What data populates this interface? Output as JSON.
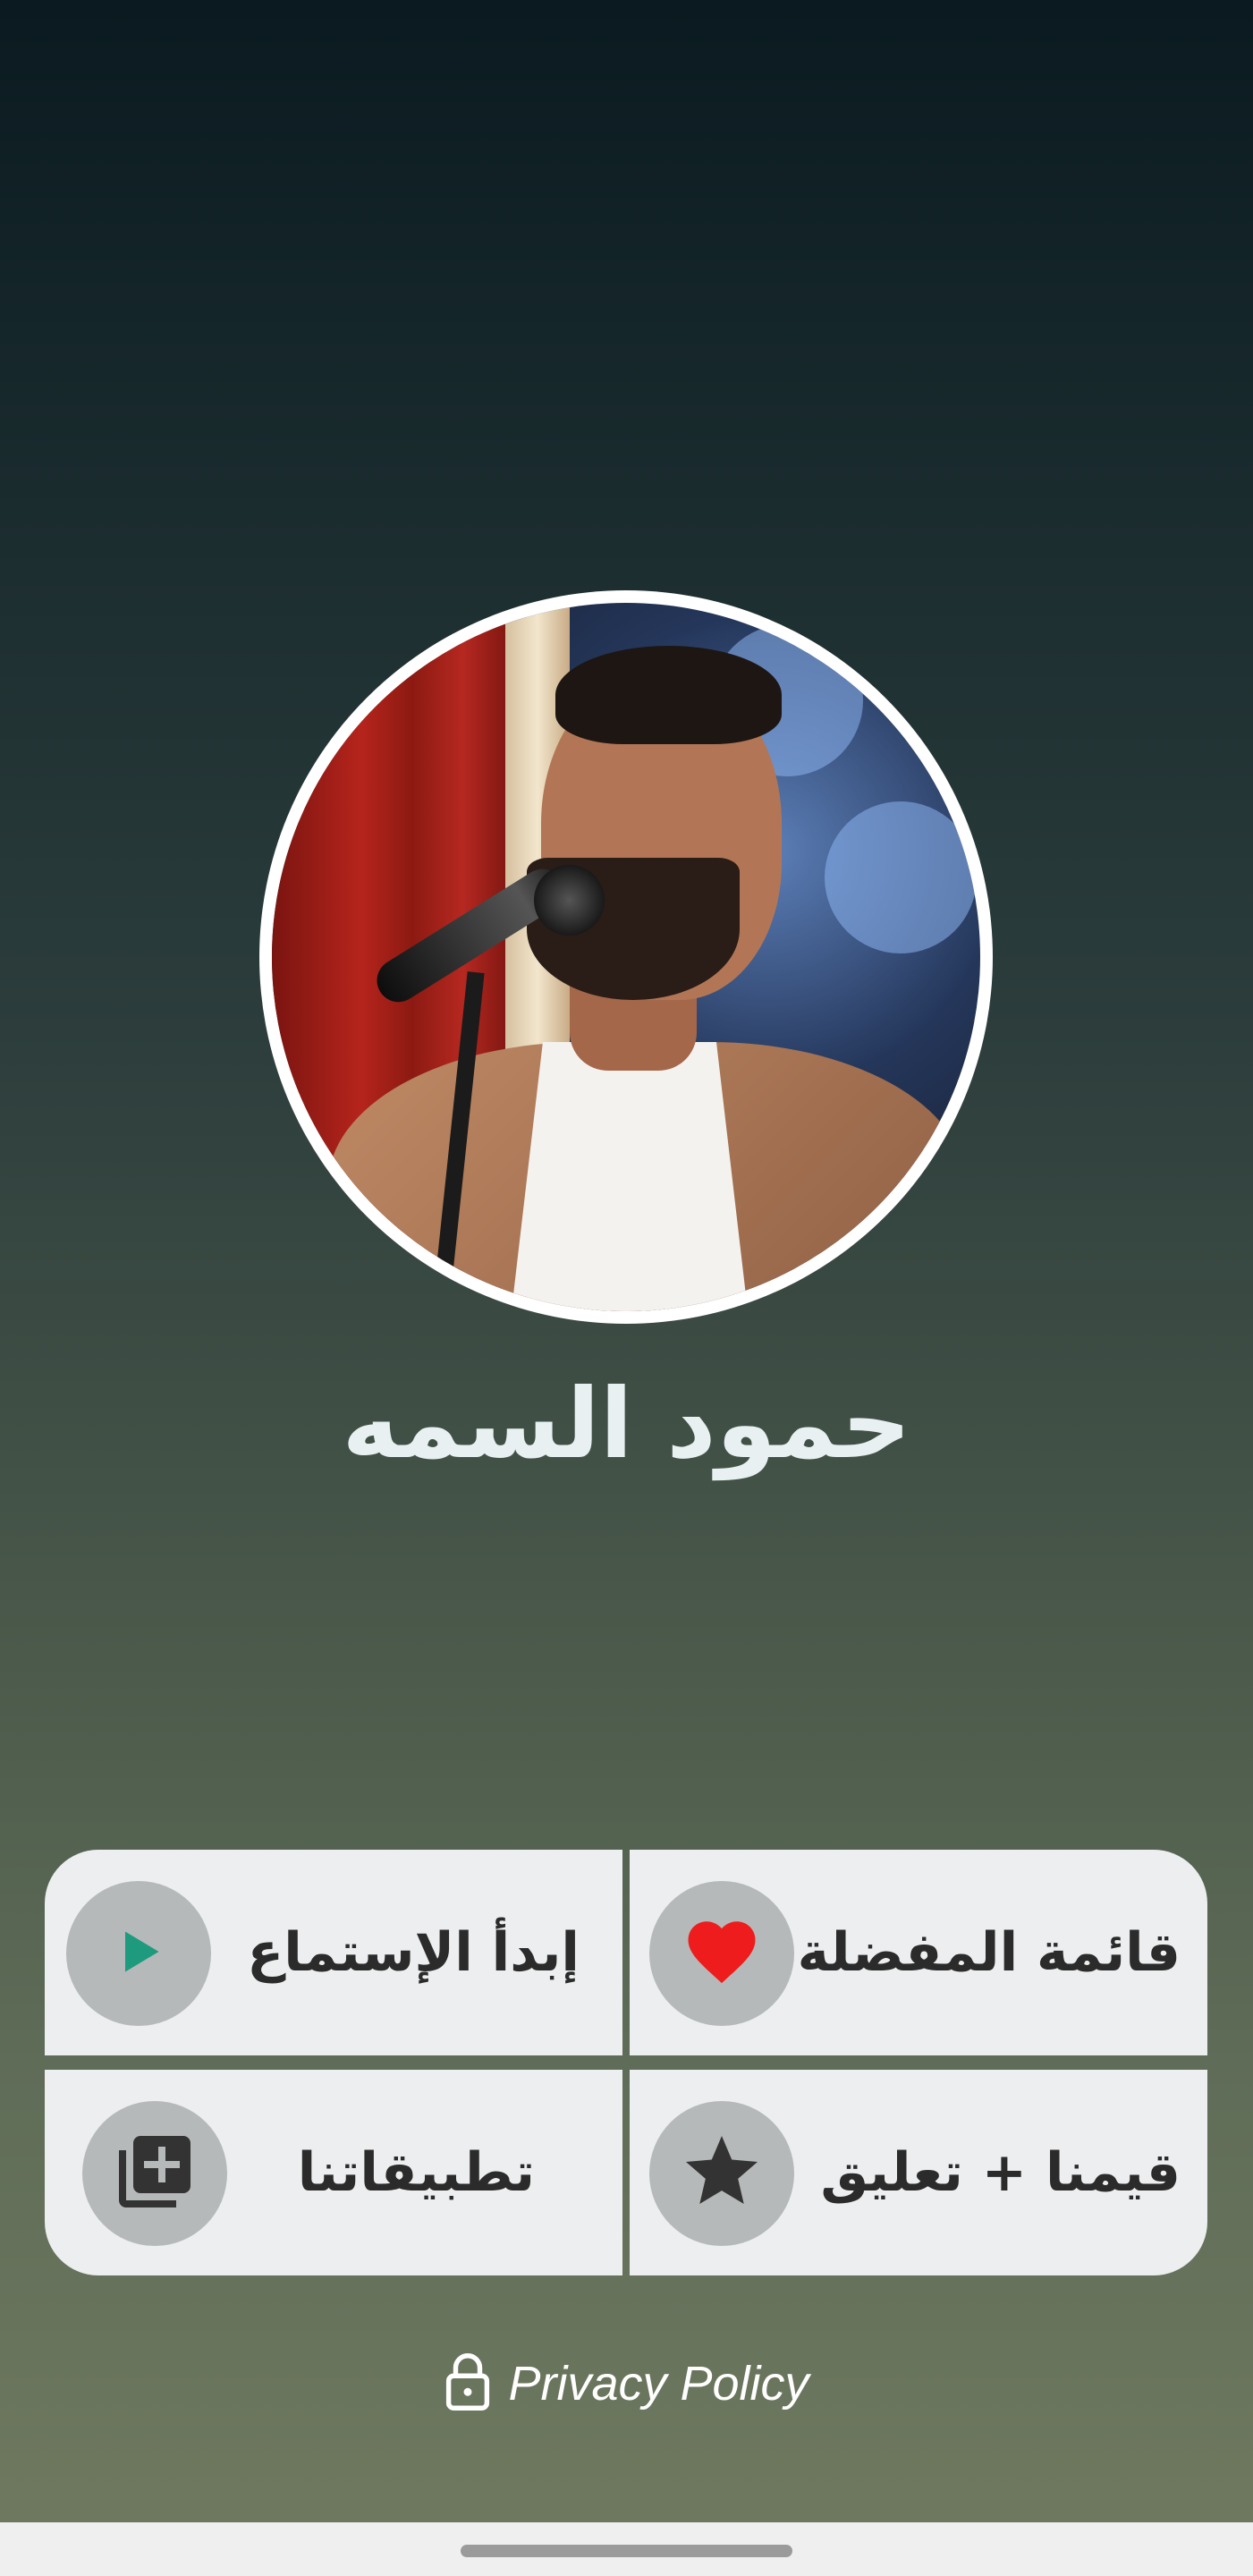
{
  "artist": {
    "name": "حمود السمه",
    "photo_alt": "Singer at microphone"
  },
  "menu": {
    "favorites": {
      "label": "قائمة المفضلة",
      "icon": "heart-icon",
      "icon_color": "#ee1c1c"
    },
    "start_listening": {
      "label": "إبدأ الإستماع",
      "icon": "play-icon",
      "icon_color": "#1e9a7e"
    },
    "rate_us": {
      "label": "قيمنا + تعليق",
      "icon": "star-icon",
      "icon_color": "#333333"
    },
    "our_apps": {
      "label": "تطبيقاتنا",
      "icon": "library-add-icon",
      "icon_color": "#333333"
    }
  },
  "privacy": {
    "label": "Privacy Policy",
    "icon": "lock-icon"
  },
  "theme": {
    "gradient_top": "#0a1a20",
    "gradient_bottom": "#707a60",
    "button_bg": "#eceeef",
    "icon_circle_bg": "#b6b9b9",
    "text_dark": "#2b2b2b",
    "name_color": "#e8f0f2"
  }
}
